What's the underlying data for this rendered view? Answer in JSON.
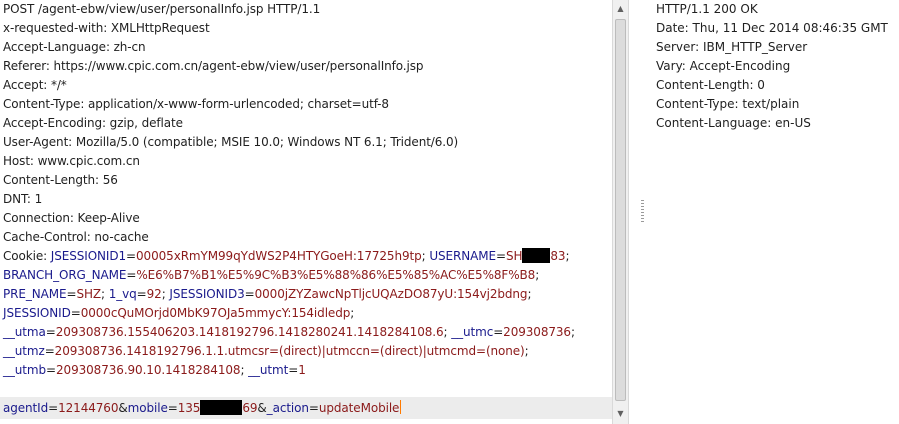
{
  "request": {
    "headers": [
      "POST /agent-ebw/view/user/personalInfo.jsp HTTP/1.1",
      "x-requested-with: XMLHttpRequest",
      "Accept-Language: zh-cn",
      "Referer: https://www.cpic.com.cn/agent-ebw/view/user/personalInfo.jsp",
      "Accept: */*",
      "Content-Type: application/x-www-form-urlencoded; charset=utf-8",
      "Accept-Encoding: gzip, deflate",
      "User-Agent: Mozilla/5.0 (compatible; MSIE 10.0; Windows NT 6.1; Trident/6.0)",
      "Host: www.cpic.com.cn",
      "Content-Length: 56",
      "DNT: 1",
      "Connection: Keep-Alive",
      "Cache-Control: no-cache"
    ],
    "cookie": {
      "label": "Cookie: ",
      "line1": {
        "n1": "JSESSIONID1",
        "v1": "00005xRmYM99qYdWS2P4HTYGoeH:17725h9tp",
        "sep": "; ",
        "n2": "USERNAME",
        "v2_pre": "SH",
        "v2_post": "83",
        "end": ";"
      },
      "line2": {
        "n": "BRANCH_ORG_NAME",
        "v": "%E6%B7%B1%E5%9C%B3%E5%88%86%E5%85%AC%E5%8F%B8",
        "end": ";"
      },
      "line3": {
        "n1": "PRE_NAME",
        "v1": "SHZ",
        "n2": "1_vq",
        "v2": "92",
        "n3": "JSESSIONID3",
        "v3": "0000jZYZawcNpTljcUQAzDO87yU:154vj2bdng",
        "sep": "; ",
        "end": ";"
      },
      "line4": {
        "n": "JSESSIONID",
        "v": "0000cQuMOrjd0MbK97OJa5mmycY:154idledp",
        "end": ";"
      },
      "line5": {
        "n1": "__utma",
        "v1": "209308736.155406203.1418192796.1418280241.1418284108.6",
        "n2": "__utmc",
        "v2": "209308736",
        "sep": "; ",
        "end": ";"
      },
      "line6": {
        "n": "__utmz",
        "v": "209308736.1418192796.1.1.utmcsr=(direct)|utmccn=(direct)|utmcmd=(none)",
        "end": ";"
      },
      "line7": {
        "n1": "__utmb",
        "v1": "209308736.90.10.1418284108",
        "n2": "__utmt",
        "v2": "1",
        "sep": "; "
      }
    },
    "body": {
      "n1": "agentId",
      "v1": "12144760",
      "amp1": "&",
      "n2": "mobile",
      "v2_pre": "135",
      "v2_post": "69",
      "amp2": "&",
      "n3": "_action",
      "v3": "updateMobile"
    }
  },
  "response": {
    "headers": [
      "HTTP/1.1 200 OK",
      "Date: Thu, 11 Dec 2014 08:46:35 GMT",
      "Server: IBM_HTTP_Server",
      "Vary: Accept-Encoding",
      "Content-Length: 0",
      "Content-Type: text/plain",
      "Content-Language: en-US"
    ]
  },
  "icons": {
    "scroll_up": "▲",
    "scroll_down": "▼"
  }
}
